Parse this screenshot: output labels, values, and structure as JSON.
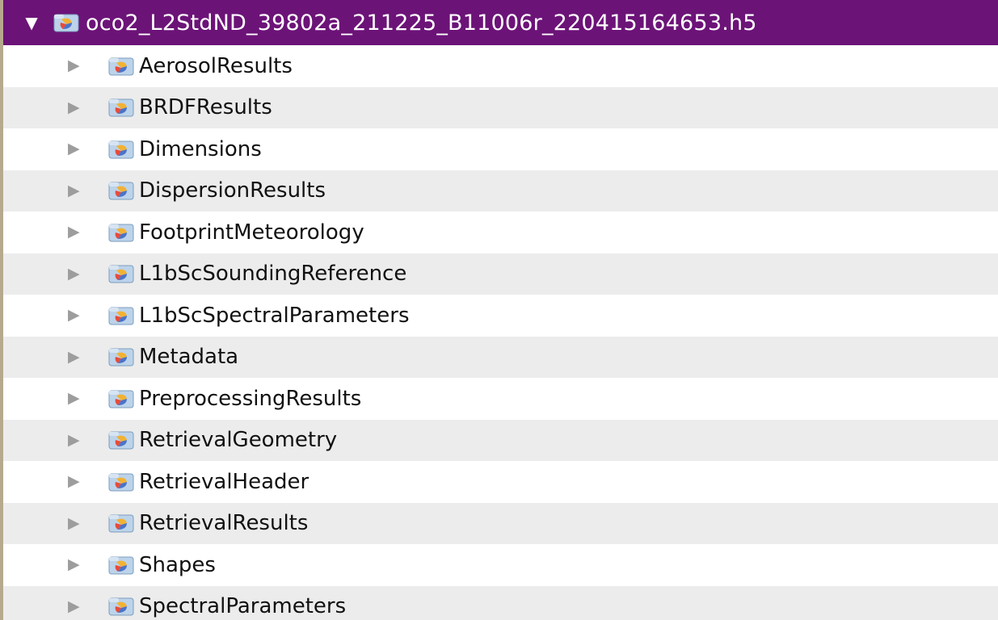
{
  "root": {
    "label": "oco2_L2StdND_39802a_211225_B11006r_220415164653.h5",
    "expanded_glyph": "▼",
    "icon": "hdf5-file-icon"
  },
  "colors": {
    "root_highlight": "#6c1378",
    "row_alt": "#ececec",
    "left_border": "#b6a98d"
  },
  "groups": [
    {
      "label": "AerosolResults",
      "icon": "hdf5-group-icon",
      "glyph": "▶"
    },
    {
      "label": "BRDFResults",
      "icon": "hdf5-group-icon",
      "glyph": "▶"
    },
    {
      "label": "Dimensions",
      "icon": "hdf5-group-icon",
      "glyph": "▶"
    },
    {
      "label": "DispersionResults",
      "icon": "hdf5-group-icon",
      "glyph": "▶"
    },
    {
      "label": "FootprintMeteorology",
      "icon": "hdf5-group-icon",
      "glyph": "▶"
    },
    {
      "label": "L1bScSoundingReference",
      "icon": "hdf5-group-icon",
      "glyph": "▶"
    },
    {
      "label": "L1bScSpectralParameters",
      "icon": "hdf5-group-icon",
      "glyph": "▶"
    },
    {
      "label": "Metadata",
      "icon": "hdf5-group-icon",
      "glyph": "▶"
    },
    {
      "label": "PreprocessingResults",
      "icon": "hdf5-group-icon",
      "glyph": "▶"
    },
    {
      "label": "RetrievalGeometry",
      "icon": "hdf5-group-icon",
      "glyph": "▶"
    },
    {
      "label": "RetrievalHeader",
      "icon": "hdf5-group-icon",
      "glyph": "▶"
    },
    {
      "label": "RetrievalResults",
      "icon": "hdf5-group-icon",
      "glyph": "▶"
    },
    {
      "label": "Shapes",
      "icon": "hdf5-group-icon",
      "glyph": "▶"
    },
    {
      "label": "SpectralParameters",
      "icon": "hdf5-group-icon",
      "glyph": "▶"
    }
  ]
}
